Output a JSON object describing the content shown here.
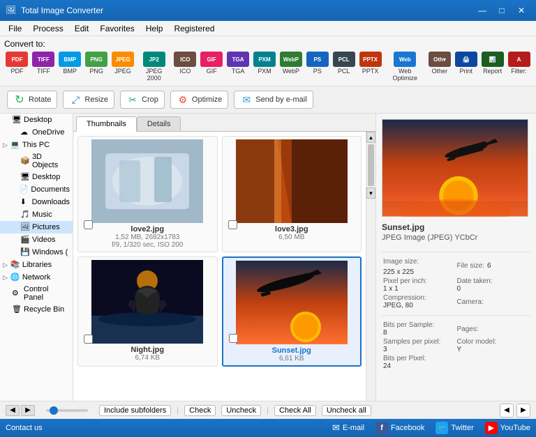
{
  "app": {
    "title": "Total Image Converter",
    "icon": "🖼"
  },
  "titlebar": {
    "minimize": "—",
    "maximize": "□",
    "close": "✕"
  },
  "menubar": {
    "items": [
      "File",
      "Process",
      "Edit",
      "Favorites",
      "Help",
      "Registered"
    ]
  },
  "toolbar": {
    "convert_label": "Convert to:",
    "formats": [
      {
        "id": "pdf",
        "label": "PDF",
        "cls": "fmt-pdf",
        "text": "PDF"
      },
      {
        "id": "tiff",
        "label": "TIFF",
        "cls": "fmt-tiff",
        "text": "TIFF"
      },
      {
        "id": "bmp",
        "label": "BMP",
        "cls": "fmt-bmp",
        "text": "BMP"
      },
      {
        "id": "png",
        "label": "PNG",
        "cls": "fmt-png",
        "text": "PNG"
      },
      {
        "id": "jpeg",
        "label": "JPEG",
        "cls": "fmt-jpeg",
        "text": "JPEG"
      },
      {
        "id": "j2k",
        "label": "JPEG 2000",
        "cls": "fmt-j2k",
        "text": "JP2"
      },
      {
        "id": "ico",
        "label": "ICO",
        "cls": "fmt-ico",
        "text": "ICO"
      },
      {
        "id": "gif",
        "label": "GIF",
        "cls": "fmt-gif",
        "text": "GIF"
      },
      {
        "id": "tga",
        "label": "TGA",
        "cls": "fmt-tga",
        "text": "TGA"
      },
      {
        "id": "pxm",
        "label": "PXM",
        "cls": "fmt-pxm",
        "text": "PXM"
      },
      {
        "id": "webp",
        "label": "WebP",
        "cls": "fmt-webp",
        "text": "WebP"
      },
      {
        "id": "ps",
        "label": "PS",
        "cls": "fmt-ps",
        "text": "PS"
      },
      {
        "id": "pcl",
        "label": "PCL",
        "cls": "fmt-pcl",
        "text": "PCL"
      },
      {
        "id": "pptx",
        "label": "PPTX",
        "cls": "fmt-pptx",
        "text": "PPTX"
      },
      {
        "id": "webopt",
        "label": "Web Optimize",
        "cls": "fmt-webopt",
        "text": "Web"
      },
      {
        "id": "other",
        "label": "Other",
        "cls": "fmt-other",
        "text": "Oth▾"
      },
      {
        "id": "print",
        "label": "Print",
        "cls": "fmt-print",
        "text": "🖨"
      },
      {
        "id": "report",
        "label": "Report",
        "cls": "fmt-report",
        "text": "📊"
      },
      {
        "id": "filter",
        "label": "Filter:",
        "cls": "fmt-filter",
        "text": "A"
      }
    ]
  },
  "actions": {
    "rotate": "Rotate",
    "resize": "Resize",
    "crop": "Crop",
    "optimize": "Optimize",
    "email": "Send by e-mail"
  },
  "tabs": {
    "thumbnails": "Thumbnails",
    "details": "Details",
    "active": "thumbnails"
  },
  "sidebar": {
    "sections": [
      {
        "id": "desktop",
        "label": "Desktop",
        "indent": 0,
        "icon": "🖥",
        "expandable": false
      },
      {
        "id": "onedrive",
        "label": "OneDrive",
        "indent": 1,
        "icon": "☁",
        "expandable": false
      },
      {
        "id": "thispc",
        "label": "This PC",
        "indent": 0,
        "icon": "💻",
        "expandable": true
      },
      {
        "id": "3dobjects",
        "label": "3D Objects",
        "indent": 1,
        "icon": "📦",
        "expandable": false
      },
      {
        "id": "desktop2",
        "label": "Desktop",
        "indent": 1,
        "icon": "🖥",
        "expandable": false
      },
      {
        "id": "documents",
        "label": "Documents",
        "indent": 1,
        "icon": "📄",
        "expandable": false
      },
      {
        "id": "downloads",
        "label": "Downloads",
        "indent": 1,
        "icon": "⬇",
        "expandable": false
      },
      {
        "id": "music",
        "label": "Music",
        "indent": 1,
        "icon": "🎵",
        "expandable": false
      },
      {
        "id": "pictures",
        "label": "Pictures",
        "indent": 1,
        "icon": "🖼",
        "expandable": false,
        "selected": true
      },
      {
        "id": "videos",
        "label": "Videos",
        "indent": 1,
        "icon": "🎬",
        "expandable": false
      },
      {
        "id": "windows",
        "label": "Windows (",
        "indent": 1,
        "icon": "💾",
        "expandable": false
      },
      {
        "id": "libraries",
        "label": "Libraries",
        "indent": 0,
        "icon": "📚",
        "expandable": true
      },
      {
        "id": "network",
        "label": "Network",
        "indent": 0,
        "icon": "🌐",
        "expandable": true
      },
      {
        "id": "controlpanel",
        "label": "Control Panel",
        "indent": 0,
        "icon": "⚙",
        "expandable": false
      },
      {
        "id": "recycle",
        "label": "Recycle Bin",
        "indent": 0,
        "icon": "🗑",
        "expandable": false
      }
    ]
  },
  "thumbnails": [
    {
      "id": "love2",
      "filename": "love2.jpg",
      "info1": "1,52 MB, 2682x1783",
      "info2": "f/9, 1/320 sec, ISO 200",
      "checked": false,
      "selected": false,
      "bg": "ice"
    },
    {
      "id": "love3",
      "filename": "love3.jpg",
      "info1": "6,50 MB",
      "info2": "",
      "checked": false,
      "selected": false,
      "bg": "canyon"
    },
    {
      "id": "night",
      "filename": "Night.jpg",
      "info1": "6,74 KB",
      "info2": "",
      "checked": false,
      "selected": false,
      "bg": "night"
    },
    {
      "id": "sunset",
      "filename": "Sunset.jpg",
      "info1": "6,61 KB",
      "info2": "",
      "checked": false,
      "selected": true,
      "bg": "sunset"
    }
  ],
  "preview": {
    "filename": "Sunset.jpg",
    "filetype": "JPEG Image (JPEG) YCbCr",
    "image_size_label": "Image size:",
    "image_size_value": "225 x 225",
    "filesize_label": "File size:",
    "filesize_value": "6",
    "ppi_label": "Pixel per inch:",
    "ppi_value": "1 x 1",
    "date_label": "Date taken:",
    "date_value": "0",
    "compression_label": "Compression:",
    "compression_value": "JPEG, 80",
    "camera_label": "Camera:",
    "camera_value": "",
    "bps_label": "Bits per Sample:",
    "bps_value": "8",
    "pages_label": "Pages:",
    "pages_value": "",
    "spp_label": "Samples per pixel:",
    "spp_value": "3",
    "color_label": "Color model:",
    "color_value": "Y",
    "bpp_label": "Bits per Pixel:",
    "bpp_value": "24"
  },
  "bottom": {
    "include_subfolders": "Include subfolders",
    "check": "Check",
    "uncheck": "Uncheck",
    "check_all": "Check All",
    "uncheck_all": "Uncheck all"
  },
  "statusbar": {
    "contact": "Contact us",
    "email": "E-mail",
    "facebook": "Facebook",
    "twitter": "Twitter",
    "youtube": "YouTube"
  }
}
